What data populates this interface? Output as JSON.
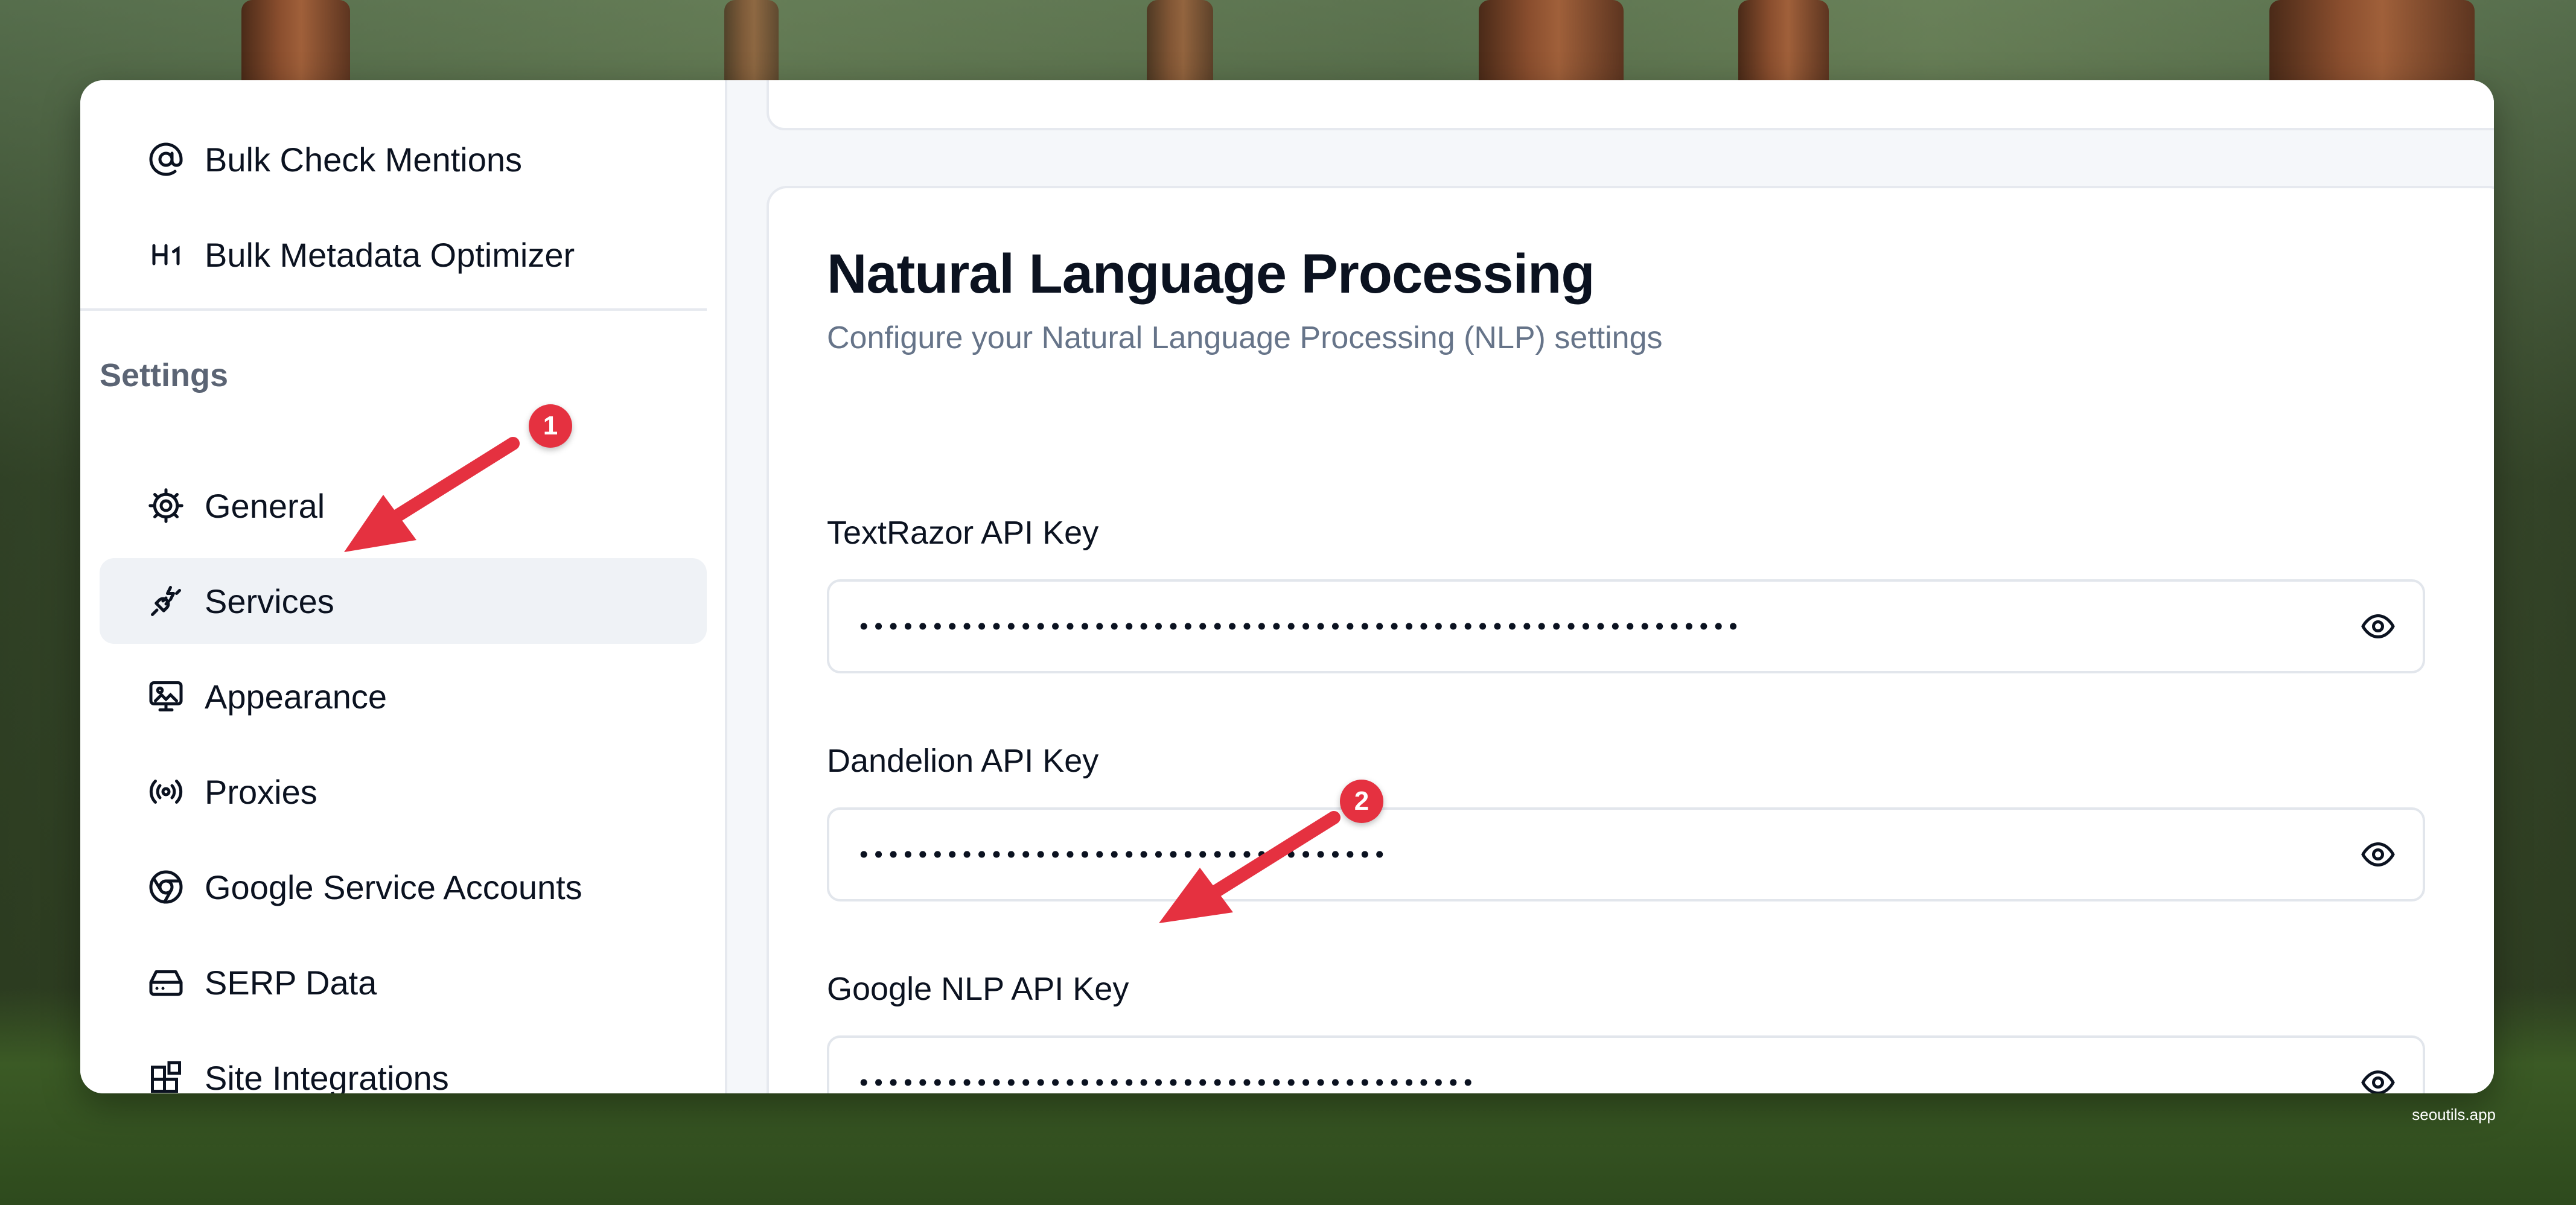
{
  "sidebar": {
    "tools": [
      {
        "label": "Bulk Check Mentions",
        "icon": "at-sign-icon"
      },
      {
        "label": "Bulk Metadata Optimizer",
        "icon": "h1-icon"
      }
    ],
    "settings_label": "Settings",
    "items": [
      {
        "label": "General",
        "icon": "gear-icon",
        "active": false
      },
      {
        "label": "Services",
        "icon": "plug-icon",
        "active": true
      },
      {
        "label": "Appearance",
        "icon": "monitor-icon",
        "active": false
      },
      {
        "label": "Proxies",
        "icon": "broadcast-icon",
        "active": false
      },
      {
        "label": "Google Service Accounts",
        "icon": "chrome-icon",
        "active": false
      },
      {
        "label": "SERP Data",
        "icon": "hard-drive-icon",
        "active": false
      },
      {
        "label": "Site Integrations",
        "icon": "blocks-icon",
        "active": false
      }
    ]
  },
  "panel": {
    "title": "Natural Language Processing",
    "subtitle": "Configure your Natural Language Processing (NLP) settings",
    "fields": [
      {
        "label": "TextRazor API Key",
        "value": "••••••••••••••••••••••••••••••••••••••••••••••••••••••••••••"
      },
      {
        "label": "Dandelion API Key",
        "value": "••••••••••••••••••••••••••••••••••••"
      },
      {
        "label": "Google NLP API Key",
        "value": "••••••••••••••••••••••••••••••••••••••••••"
      }
    ]
  },
  "annotations": [
    "1",
    "2"
  ],
  "watermark": "seoutils.app",
  "colors": {
    "accent_red": "#e53140",
    "active_bg": "#eff2f6",
    "text": "#0b1220",
    "muted": "#667489"
  }
}
